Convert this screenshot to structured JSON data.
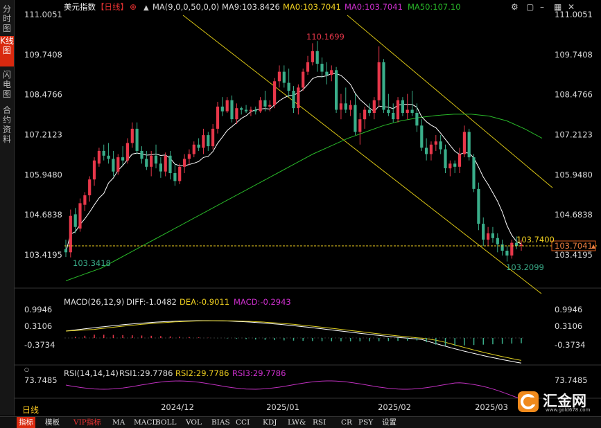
{
  "sidebar": {
    "items": [
      {
        "label": "分时图",
        "active": false
      },
      {
        "label": "K线图",
        "active": true
      },
      {
        "label": "闪电图",
        "active": false
      },
      {
        "label": "合约资料",
        "active": false
      }
    ]
  },
  "header": {
    "symbol": "美元指数",
    "period_tag": "【日线】",
    "add_icon": "circle-plus-icon",
    "ma_indicator": "MA(9,0,0,50,0,0)",
    "ma9": "MA9:103.8426",
    "ma0_a": "MA0:103.7041",
    "ma0_b": "MA0:103.7041",
    "ma50": "MA50:107.10",
    "window_icons": [
      "settings-icon",
      "window-icon",
      "minimize-icon",
      "tile-icon",
      "close-icon"
    ]
  },
  "macd": {
    "title": "MACD(26,12,9)",
    "diff": "DIFF:-1.0482",
    "dea": "DEA:-0.9011",
    "macd": "MACD:-0.2943",
    "ticks": [
      "0.9946",
      "0.3106",
      "-0.3734"
    ]
  },
  "rsi": {
    "title": "RSI(14,14,14)",
    "rsi1": "RSI1:29.7786",
    "rsi2": "RSI2:29.7786",
    "rsi3": "RSI3:29.7786",
    "ticks": [
      "73.7485"
    ]
  },
  "period_label": "日线",
  "toolbar": {
    "items": [
      "指标",
      "模板",
      "VIP指标",
      "MA",
      "MACD",
      "BOLL",
      "VOL",
      "BIAS",
      "CCI",
      "KDJ",
      "LW&",
      "RSI",
      "CR",
      "PSY",
      "设置"
    ]
  },
  "logo": {
    "text": "汇金网",
    "url": "www.gold678.com"
  },
  "colors": {
    "up": "#e8374a",
    "down": "#3aae8a",
    "ma9": "#ffffff",
    "ma50": "#29b829",
    "trend": "#d9c414",
    "price_line": "#f0d020",
    "price_box": "#e06020",
    "macd_diff": "#ffffff",
    "macd_dea": "#e0d020",
    "macd_hist": "#e8374a",
    "rsi": "#c030c0"
  },
  "chart_data": {
    "type": "candlestick",
    "y_ticks": [
      "111.0051",
      "109.7408",
      "108.4766",
      "107.2123",
      "105.9480",
      "104.6838",
      "103.4195"
    ],
    "ylim": [
      103.0,
      111.2
    ],
    "x_ticks": [
      "2024/12",
      "2025/01",
      "2025/02",
      "2025/03"
    ],
    "annotations": {
      "high": "110.1699",
      "low_left": "103.3418",
      "low_right": "103.2099",
      "last_close": "103.7400"
    },
    "current_price": "103.7041",
    "ohlc": [
      [
        103.6,
        103.9,
        103.35,
        103.5
      ],
      [
        103.5,
        104.85,
        103.34,
        104.65
      ],
      [
        104.7,
        104.9,
        104.1,
        104.3
      ],
      [
        104.25,
        105.2,
        104.15,
        105.05
      ],
      [
        105.0,
        105.4,
        104.8,
        105.3
      ],
      [
        105.3,
        105.9,
        105.1,
        105.8
      ],
      [
        105.8,
        106.5,
        105.6,
        106.4
      ],
      [
        106.3,
        106.8,
        106.2,
        106.7
      ],
      [
        106.7,
        106.9,
        106.4,
        106.55
      ],
      [
        106.55,
        106.95,
        106.3,
        106.45
      ],
      [
        106.45,
        106.7,
        105.9,
        106.05
      ],
      [
        106.05,
        106.6,
        105.95,
        106.5
      ],
      [
        106.5,
        106.85,
        106.25,
        106.4
      ],
      [
        106.4,
        107.1,
        106.3,
        106.95
      ],
      [
        106.95,
        107.6,
        106.8,
        107.4
      ],
      [
        107.4,
        107.6,
        106.6,
        106.7
      ],
      [
        106.7,
        106.85,
        106.3,
        106.45
      ],
      [
        106.45,
        106.7,
        106.1,
        106.2
      ],
      [
        106.2,
        106.7,
        105.9,
        106.55
      ],
      [
        106.55,
        106.9,
        106.15,
        106.3
      ],
      [
        106.3,
        106.5,
        105.85,
        106.05
      ],
      [
        106.05,
        106.65,
        105.9,
        106.55
      ],
      [
        106.55,
        106.7,
        105.8,
        106.0
      ],
      [
        106.0,
        106.3,
        105.6,
        105.75
      ],
      [
        105.75,
        106.3,
        105.65,
        106.2
      ],
      [
        106.2,
        106.6,
        106.0,
        106.45
      ],
      [
        106.45,
        106.75,
        106.25,
        106.6
      ],
      [
        106.6,
        107.0,
        106.5,
        106.9
      ],
      [
        106.9,
        107.1,
        106.7,
        106.8
      ],
      [
        106.8,
        107.4,
        106.6,
        107.2
      ],
      [
        107.2,
        107.3,
        106.7,
        106.85
      ],
      [
        106.85,
        107.55,
        106.75,
        107.4
      ],
      [
        107.4,
        108.25,
        107.25,
        108.1
      ],
      [
        108.1,
        108.4,
        107.8,
        107.95
      ],
      [
        107.95,
        108.4,
        107.9,
        108.3
      ],
      [
        108.3,
        108.45,
        107.6,
        107.7
      ],
      [
        107.7,
        108.2,
        107.55,
        108.05
      ],
      [
        108.05,
        108.1,
        107.85,
        108.0
      ],
      [
        108.0,
        108.15,
        107.9,
        107.95
      ],
      [
        107.95,
        108.1,
        107.8,
        108.0
      ],
      [
        108.0,
        108.1,
        107.85,
        107.95
      ],
      [
        107.95,
        108.4,
        107.9,
        108.3
      ],
      [
        108.3,
        108.6,
        107.95,
        108.1
      ],
      [
        108.1,
        108.3,
        107.95,
        108.15
      ],
      [
        108.15,
        109.0,
        108.05,
        108.9
      ],
      [
        108.9,
        109.4,
        108.7,
        109.2
      ],
      [
        109.2,
        109.4,
        108.7,
        108.85
      ],
      [
        108.85,
        109.3,
        108.4,
        108.6
      ],
      [
        108.6,
        108.75,
        107.9,
        108.05
      ],
      [
        108.05,
        108.8,
        107.85,
        108.7
      ],
      [
        108.7,
        109.3,
        108.6,
        109.2
      ],
      [
        109.2,
        109.7,
        109.1,
        109.5
      ],
      [
        109.5,
        110.1,
        109.4,
        109.85
      ],
      [
        109.85,
        110.17,
        109.2,
        109.45
      ],
      [
        109.45,
        109.65,
        109.0,
        109.2
      ],
      [
        109.2,
        109.5,
        108.8,
        109.1
      ],
      [
        109.1,
        109.4,
        108.9,
        109.25
      ],
      [
        109.25,
        109.35,
        107.9,
        108.0
      ],
      [
        108.0,
        108.5,
        107.7,
        108.2
      ],
      [
        108.2,
        108.7,
        107.9,
        108.0
      ],
      [
        108.0,
        108.3,
        107.8,
        108.15
      ],
      [
        108.15,
        108.5,
        107.2,
        107.3
      ],
      [
        107.3,
        107.9,
        106.9,
        107.7
      ],
      [
        107.7,
        108.1,
        107.4,
        108.0
      ],
      [
        108.0,
        108.2,
        107.8,
        107.9
      ],
      [
        107.9,
        108.4,
        107.7,
        108.3
      ],
      [
        108.3,
        110.0,
        108.1,
        109.5
      ],
      [
        109.5,
        109.6,
        107.9,
        108.0
      ],
      [
        108.0,
        108.5,
        107.8,
        107.9
      ],
      [
        107.9,
        108.2,
        107.6,
        107.7
      ],
      [
        107.7,
        108.4,
        107.6,
        108.3
      ],
      [
        108.3,
        108.4,
        107.8,
        107.9
      ],
      [
        107.9,
        108.5,
        107.7,
        108.0
      ],
      [
        108.0,
        108.6,
        107.8,
        107.9
      ],
      [
        107.9,
        108.2,
        107.3,
        107.5
      ],
      [
        107.5,
        107.7,
        106.7,
        106.8
      ],
      [
        106.8,
        107.1,
        106.4,
        106.6
      ],
      [
        106.6,
        107.0,
        106.4,
        106.9
      ],
      [
        106.9,
        107.2,
        106.7,
        107.0
      ],
      [
        107.0,
        107.2,
        106.6,
        106.75
      ],
      [
        106.75,
        106.9,
        106.0,
        106.15
      ],
      [
        106.15,
        106.4,
        105.9,
        106.3
      ],
      [
        106.3,
        106.4,
        106.0,
        106.2
      ],
      [
        106.2,
        106.8,
        106.0,
        106.6
      ],
      [
        106.6,
        107.5,
        106.5,
        107.3
      ],
      [
        107.3,
        107.4,
        106.4,
        106.5
      ],
      [
        106.5,
        106.6,
        105.4,
        105.5
      ],
      [
        105.5,
        105.7,
        104.2,
        104.4
      ],
      [
        104.4,
        104.6,
        103.7,
        103.9
      ],
      [
        103.9,
        104.3,
        103.7,
        104.1
      ],
      [
        104.1,
        104.3,
        103.8,
        103.95
      ],
      [
        103.95,
        104.1,
        103.5,
        103.75
      ],
      [
        103.75,
        103.9,
        103.4,
        103.55
      ],
      [
        103.55,
        103.7,
        103.21,
        103.4
      ],
      [
        103.4,
        103.9,
        103.3,
        103.8
      ],
      [
        103.8,
        104.0,
        103.6,
        103.7
      ],
      [
        103.7,
        103.9,
        103.55,
        103.74
      ]
    ],
    "ma50_line": {
      "start": 102.7,
      "end": 107.1
    }
  }
}
